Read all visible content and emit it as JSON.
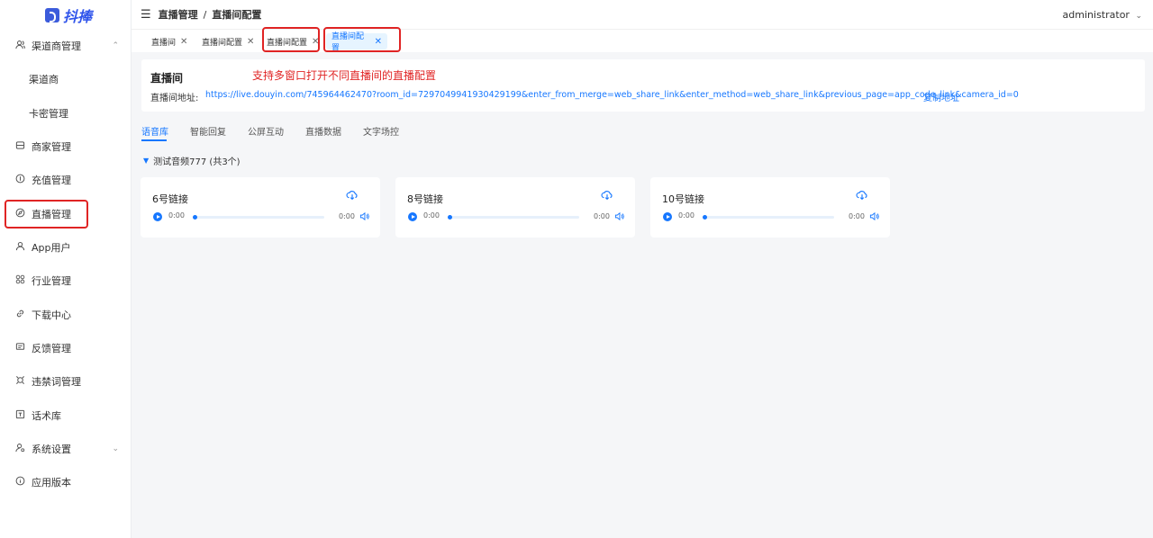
{
  "app": {
    "logo_text": "抖捧"
  },
  "sidebar": {
    "items": [
      {
        "label": "渠道商管理",
        "icon": "users-icon"
      },
      {
        "label": "渠道商"
      },
      {
        "label": "卡密管理"
      },
      {
        "label": "商家管理",
        "icon": "store-icon"
      },
      {
        "label": "充值管理",
        "icon": "coin-icon"
      },
      {
        "label": "直播管理",
        "icon": "compass-icon"
      },
      {
        "label": "App用户",
        "icon": "user-icon"
      },
      {
        "label": "行业管理",
        "icon": "grid-icon"
      },
      {
        "label": "下载中心",
        "icon": "link-icon"
      },
      {
        "label": "反馈管理",
        "icon": "message-icon"
      },
      {
        "label": "违禁词管理",
        "icon": "ban-icon"
      },
      {
        "label": "话术库",
        "icon": "book-icon"
      },
      {
        "label": "系统设置",
        "icon": "settings-icon"
      },
      {
        "label": "应用版本",
        "icon": "info-icon"
      }
    ]
  },
  "header": {
    "breadcrumb": [
      "直播管理",
      "直播间配置"
    ],
    "separator": "/",
    "user": "administrator"
  },
  "tabs": [
    {
      "label": "直播间"
    },
    {
      "label": "直播间配置"
    },
    {
      "label": "直播间配置"
    },
    {
      "label": "直播间配置",
      "active": true
    }
  ],
  "info": {
    "title": "直播间",
    "note": "支持多窗口打开不同直播间的直播配置",
    "address_label": "直播间地址:",
    "address": "https://live.douyin.com/745964462470?room_id=7297049941930429199&enter_from_merge=web_share_link&enter_method=web_share_link&previous_page=app_code_link&camera_id=0",
    "copy_label": "复制地址"
  },
  "subtabs": [
    "语音库",
    "智能回复",
    "公屏互动",
    "直播数据",
    "文字场控"
  ],
  "group": {
    "label": "测试音频777 (共3个)"
  },
  "cards": [
    {
      "title": "6号链接",
      "current": "0:00",
      "duration": "0:00"
    },
    {
      "title": "8号链接",
      "current": "0:00",
      "duration": "0:00"
    },
    {
      "title": "10号链接",
      "current": "0:00",
      "duration": "0:00"
    }
  ],
  "colors": {
    "accent": "#1677ff",
    "annotation": "#e02424"
  }
}
